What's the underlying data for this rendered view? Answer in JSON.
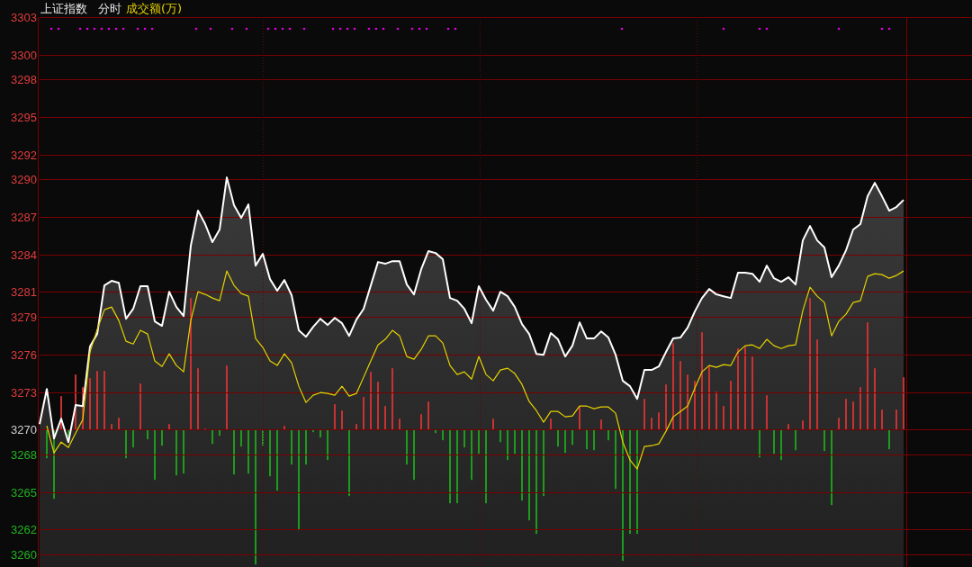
{
  "header": {
    "title": "上证指数",
    "mode": "分时",
    "indicator": "成交额(万)"
  },
  "chart": {
    "chart_data": {
      "type": "line",
      "ylim": [
        3260,
        3303
      ],
      "grid": true,
      "yticks": [
        3303,
        3300,
        3298,
        3295,
        3292,
        3290,
        3287,
        3284,
        3281,
        3279,
        3276,
        3273,
        3270,
        3268,
        3265,
        3262,
        3260
      ],
      "series": [
        {
          "color": "#ffffff",
          "values": [
            3270.43,
            3273.24,
            3269.28,
            3270.86,
            3268.99,
            3271.95,
            3271.87,
            3276.63,
            3277.64,
            3281.53,
            3281.89,
            3281.74,
            3278.86,
            3279.65,
            3281.46,
            3281.46,
            3278.65,
            3278.29,
            3281.02,
            3279.8,
            3279.08,
            3284.7,
            3287.51,
            3286.43,
            3284.99,
            3286.0,
            3290.17,
            3287.94,
            3286.93,
            3288.01,
            3283.11,
            3284.05,
            3282.03,
            3281.1,
            3281.96,
            3280.74,
            3277.93,
            3277.42,
            3278.21,
            3278.86,
            3278.36,
            3278.93,
            3278.5,
            3277.49,
            3278.79,
            3279.65,
            3281.53,
            3283.4,
            3283.26,
            3283.47,
            3283.47,
            3281.6,
            3280.81,
            3282.82,
            3284.27,
            3284.12,
            3283.62,
            3280.52,
            3280.3,
            3279.65,
            3278.5,
            3281.46,
            3280.38,
            3279.51,
            3281.02,
            3280.66,
            3279.8,
            3278.43,
            3277.64,
            3276.05,
            3275.98,
            3277.71,
            3277.21,
            3275.84,
            3276.7,
            3278.57,
            3277.28,
            3277.28,
            3277.85,
            3277.35,
            3275.98,
            3273.89,
            3273.46,
            3272.45,
            3274.76,
            3274.76,
            3275.04,
            3276.2,
            3277.28,
            3277.35,
            3278.14,
            3279.44,
            3280.52,
            3281.24,
            3280.81,
            3280.66,
            3280.52,
            3282.54,
            3282.54,
            3282.46,
            3281.82,
            3283.11,
            3282.1,
            3281.82,
            3282.18,
            3281.6,
            3285.13,
            3286.28,
            3285.13,
            3284.56,
            3282.18,
            3283.11,
            3284.34,
            3286.0,
            3286.43,
            3288.66,
            3289.74,
            3288.66,
            3287.51,
            3287.8,
            3288.37
          ]
        },
        {
          "color": "#e6d200",
          "values": [
            null,
            3270.29,
            3268.13,
            3268.99,
            3268.56,
            3269.71,
            3270.79,
            3276.2,
            3278.0,
            3279.58,
            3279.8,
            3278.72,
            3277.06,
            3276.84,
            3277.93,
            3277.64,
            3275.48,
            3275.04,
            3276.05,
            3275.12,
            3274.61,
            3278.72,
            3281.02,
            3280.81,
            3280.52,
            3280.3,
            3282.68,
            3281.53,
            3280.88,
            3280.66,
            3277.28,
            3276.56,
            3275.48,
            3275.12,
            3276.05,
            3275.33,
            3273.46,
            3272.16,
            3272.74,
            3272.95,
            3272.88,
            3272.74,
            3273.46,
            3272.67,
            3272.88,
            3274.18,
            3275.48,
            3276.77,
            3277.21,
            3277.93,
            3277.49,
            3275.84,
            3275.62,
            3276.41,
            3277.49,
            3277.49,
            3276.92,
            3275.12,
            3274.4,
            3274.61,
            3274.03,
            3275.84,
            3274.4,
            3273.89,
            3274.76,
            3274.9,
            3274.47,
            3273.6,
            3272.23,
            3271.51,
            3270.58,
            3271.44,
            3271.44,
            3271.01,
            3271.08,
            3271.87,
            3271.87,
            3271.66,
            3271.8,
            3271.8,
            3271.3,
            3268.99,
            3267.55,
            3266.83,
            3268.63,
            3268.7,
            3268.85,
            3269.86,
            3271.01,
            3271.44,
            3271.87,
            3273.31,
            3274.61,
            3275.12,
            3274.97,
            3275.19,
            3275.12,
            3276.2,
            3276.7,
            3276.77,
            3276.48,
            3277.21,
            3276.7,
            3276.48,
            3276.7,
            3276.77,
            3279.51,
            3281.38,
            3280.66,
            3280.16,
            3277.49,
            3278.65,
            3279.22,
            3280.16,
            3280.3,
            3282.25,
            3282.46,
            3282.39,
            3282.1,
            3282.32,
            3282.68
          ]
        }
      ]
    }
  }
}
